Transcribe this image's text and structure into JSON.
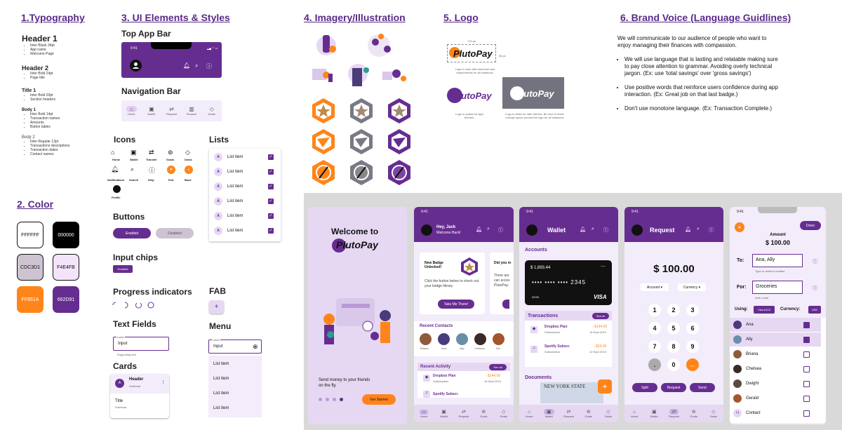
{
  "sections": {
    "typography": "1.Typography",
    "color": "2. Color",
    "ui": "3. UI Elements & Styles",
    "imagery": "4. Imagery/Illustration",
    "logo": "5. Logo",
    "voice": "6. Brand Voice (Language Guidlines)"
  },
  "typography": [
    {
      "name": "Header 1",
      "notes": [
        "Inter Black 34pt",
        "App name",
        "Welcome Page"
      ]
    },
    {
      "name": "Header 2",
      "notes": [
        "Inter Bold 24pt",
        "Page title"
      ]
    },
    {
      "name": "Title 1",
      "notes": [
        "Inter Bold 20pt",
        "Section headers"
      ]
    },
    {
      "name": "Body 1",
      "notes": [
        "Inter Bold 14pt",
        "Transaction names",
        "Amounts",
        "Button lables"
      ]
    },
    {
      "name": "Body 2",
      "notes": [
        "Inter Regular 13pt",
        "Transactions descriptions",
        "Transaction dates",
        "Contact names"
      ]
    }
  ],
  "colors": [
    {
      "hex": "FFFFFF",
      "bg": "#FFFFFF",
      "fg": "#111111"
    },
    {
      "hex": "000000",
      "bg": "#000000",
      "fg": "#FFFFFF"
    },
    {
      "hex": "CDC3D1",
      "bg": "#CDC3D1",
      "fg": "#111111"
    },
    {
      "hex": "F4E4FB",
      "bg": "#F4E4FB",
      "fg": "#111111"
    },
    {
      "hex": "FF851A",
      "bg": "#FF851A",
      "fg": "#FFFFFF"
    },
    {
      "hex": "662D91",
      "bg": "#662D91",
      "fg": "#FFFFFF"
    }
  ],
  "ui": {
    "top_app_bar": "Top App Bar",
    "time": "9:41",
    "navigation_bar": "Navigation Bar",
    "nav_items": [
      "Home",
      "Wallet",
      "Request",
      "Finance",
      "Deals"
    ],
    "icons_title": "Icons",
    "icons": [
      "Home",
      "Wallet",
      "Transfer",
      "Goals",
      "Deals",
      "Notifications",
      "Search",
      "Help",
      "Exit",
      "Back",
      "Profile"
    ],
    "buttons_title": "Buttons",
    "enabled": "Enabled",
    "disabled": "Disabled",
    "chips_title": "Input chips",
    "progress_title": "Progress indicators",
    "textfields_title": "Text Fields",
    "tf_label": "Label",
    "tf_input": "Input",
    "tf_support": "Supporting text",
    "cards_title": "Cards",
    "card_header": "Header",
    "card_subhead": "Subhead",
    "card_title": "Title",
    "card_avatar": "A",
    "lists_title": "Lists",
    "list_item": "List item",
    "fab_title": "FAB",
    "menu_title": "Menu",
    "menu_label": "Label",
    "menu_input": "Input",
    "menu_items": [
      "List item",
      "List item",
      "List item",
      "List item"
    ]
  },
  "logo": {
    "dim_w": "174 px",
    "dim_h": "58 px",
    "name": "PlutoPay",
    "cap1": "Logo in color with minimum size requirements for all instances.",
    "cap2": "Logo in purple for light themes.",
    "cap3": "Logo in white for dark themes. Be sure to leave enough space around the logo for all instances"
  },
  "voice": {
    "intro": "We will communicate to our audience of people who want to enjoy managing their finances with compassion.",
    "points": [
      "We will use language that is lasting and relatable making sure to pay close attention to grammar. Avoiding overly technical jargon. (Ex: use 'total savings' over 'gross savings')",
      "Use positive words that reinforce users confidence during app interaction. (Ex: Great job on that last badge.)",
      "Don't use monotone language. (Ex: Transaction Complete.)"
    ]
  },
  "screens": {
    "welcome": {
      "title": "Welcome to",
      "brand": "PlutoPay",
      "tagline": "Send money to your friends on the fly.",
      "cta": "Get Started"
    },
    "home": {
      "greeting": "Hey, Jack",
      "sub": "Welcome Back!",
      "card1_title": "New Badge Unlocked!",
      "card1_body": "Click the button below to check out your badge library.",
      "card1_btn": "Take Me There!",
      "card2_title": "Did you m",
      "card2_body": "There are can acces PlutoPay.",
      "contacts_title": "Recent Contacts",
      "contacts": [
        "Briana",
        "Ana",
        "Ally",
        "Chelsea",
        "Dw"
      ],
      "activity_title": "Recent Activity",
      "see_all": "See all",
      "activity": [
        {
          "name": "Dropbox Plan",
          "sub": "Subscription",
          "amt": "- $144.00",
          "date": "16 Sept 2019"
        },
        {
          "name": "Spotify Subscr.",
          "sub": "",
          "amt": "",
          "date": ""
        }
      ]
    },
    "wallet": {
      "title": "Wallet",
      "accounts": "Accounts",
      "balance": "$ 1,893.44",
      "card_num": "•••• •••• •••• 2345",
      "exp": "02/30",
      "brand": "VISA",
      "transactions": "Transactions",
      "see_all": "See all",
      "tx": [
        {
          "name": "Dropbox Plan",
          "sub": "Subscription",
          "amt": "- $144.00",
          "date": "16 Sept 2019"
        },
        {
          "name": "Spotify Subscr.",
          "sub": "Subscription",
          "amt": "- $24.00",
          "date": "12 Sept 2019"
        }
      ],
      "documents": "Documents",
      "doc_text": "NEW YORK STATE"
    },
    "request": {
      "title": "Request",
      "amount": "$ 100.00",
      "account": "Account",
      "currency": "Currency",
      "keys": [
        "1",
        "2",
        "3",
        "4",
        "5",
        "6",
        "7",
        "8",
        "9",
        ".",
        "0"
      ],
      "split": "Split",
      "request": "Request",
      "send": "Send"
    },
    "contacts": {
      "done": "Done",
      "amount_label": "Amount",
      "amount": "$ 100.00",
      "to_label": "To:",
      "to_value": "Ana, Ally",
      "to_hint": "Type or select a contact",
      "for_label": "For:",
      "for_value": "Groceries",
      "for_hint": "Add a note",
      "using_label": "Using:",
      "using_value": "Visa #123",
      "currency_label": "Currency:",
      "currency_value": "USD",
      "list": [
        {
          "name": "Ana",
          "on": true
        },
        {
          "name": "Ally",
          "on": true
        },
        {
          "name": "Briana",
          "on": false
        },
        {
          "name": "Chelsea",
          "on": false
        },
        {
          "name": "Dwight",
          "on": false
        },
        {
          "name": "Gerald",
          "on": false
        },
        {
          "name": "Contact",
          "on": false
        }
      ]
    },
    "bottom_nav": [
      "Home",
      "Wallet",
      "Request",
      "Goals",
      "Deals"
    ]
  }
}
